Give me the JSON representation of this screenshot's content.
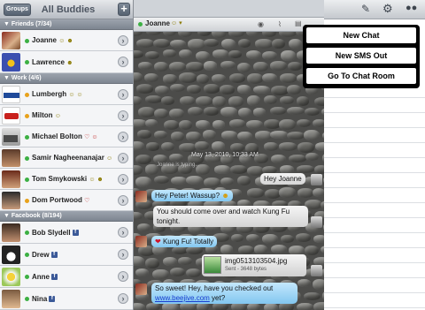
{
  "buddies_header": {
    "groups_label": "Groups",
    "title": "All Buddies",
    "add_label": "+"
  },
  "sections": [
    {
      "label": "Friends (7/34)"
    },
    {
      "label": "Work (4/6)"
    },
    {
      "label": "Facebook (8/194)"
    }
  ],
  "buddies": [
    {
      "name": "Joanne",
      "emotes": "☺ ☻",
      "status": "#3cb043"
    },
    {
      "name": "Lawrence",
      "emotes": "☻",
      "status": "#3cb043"
    },
    {
      "name": "Lumbergh",
      "emotes": "☺ ☺",
      "status": "#e8a21c"
    },
    {
      "name": "Milton",
      "emotes": "☺",
      "status": "#e8a21c"
    },
    {
      "name": "Michael Bolton",
      "emotes": "♡ ☺",
      "status": "#3cb043"
    },
    {
      "name": "Samir Nagheenanajar",
      "emotes": "☺",
      "status": "#3cb043"
    },
    {
      "name": "Tom Smykowski",
      "emotes": "☺ ☻",
      "status": "#3cb043"
    },
    {
      "name": "Dom Portwood",
      "emotes": "♡",
      "status": "#e8a21c"
    },
    {
      "name": "Bob Slydell",
      "fb": "f",
      "status": "#3cb043"
    },
    {
      "name": "Drew",
      "fb": "f",
      "status": "#3cb043"
    },
    {
      "name": "Anne",
      "fb": "f",
      "status": "#3cb043"
    },
    {
      "name": "Nina",
      "fb": "f",
      "status": "#3cb043"
    }
  ],
  "chat": {
    "contact": "Joanne",
    "timestamp": "May 13, 2010, 10:33 AM",
    "typing": "Joanne is typing...",
    "messages": [
      {
        "text": "Hey Joanne"
      },
      {
        "text": "Hey Peter! Wassup?"
      },
      {
        "text": "You should come over and watch Kung Fu tonight."
      },
      {
        "text": "Kung Fu! Totally"
      },
      {
        "file_name": "img0513103504.jpg",
        "file_info": "Sent - 3648 bytes"
      },
      {
        "text_a": "So sweet! Hey, have you checked out",
        "link": "www.beejive.com",
        "text_b": "yet?"
      }
    ]
  },
  "menu": {
    "items": [
      "New Chat",
      "New SMS Out",
      "Go To Chat Room"
    ]
  },
  "icons": [
    "compose-icon",
    "gear-icon",
    "buddies-icon"
  ]
}
